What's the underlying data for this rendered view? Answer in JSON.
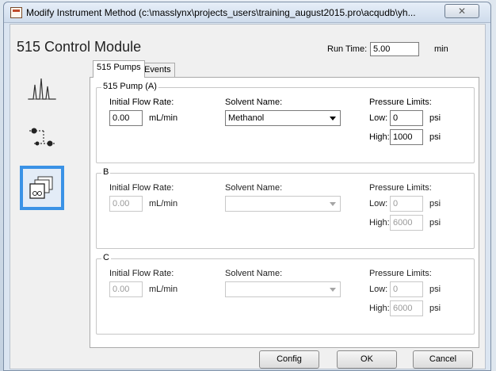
{
  "window": {
    "title": "Modify Instrument Method (c:\\masslynx\\projects_users\\training_august2015.pro\\acqudb\\yh...",
    "close_glyph": "✕"
  },
  "module": {
    "title": "515 Control Module",
    "run_time_label": "Run Time:",
    "run_time_value": "5.00",
    "run_time_unit": "min"
  },
  "sidebar": {
    "items": [
      {
        "icon": "chromatogram-icon"
      },
      {
        "icon": "flow-diagram-icon"
      },
      {
        "icon": "pump-module-icon"
      }
    ]
  },
  "tabs": [
    {
      "label": "515 Pumps"
    },
    {
      "label": "Events"
    }
  ],
  "pumps": [
    {
      "legend": "515 Pump (A)",
      "flow_label": "Initial Flow Rate:",
      "flow_value": "0.00",
      "flow_unit": "mL/min",
      "solvent_label": "Solvent Name:",
      "solvent_value": "Methanol",
      "pressure_label": "Pressure Limits:",
      "low_label": "Low:",
      "low_value": "0",
      "high_label": "High:",
      "high_value": "1000",
      "pressure_unit": "psi"
    },
    {
      "legend": "B",
      "flow_label": "Initial Flow Rate:",
      "flow_value": "0.00",
      "flow_unit": "mL/min",
      "solvent_label": "Solvent Name:",
      "solvent_value": "",
      "pressure_label": "Pressure Limits:",
      "low_label": "Low:",
      "low_value": "0",
      "high_label": "High:",
      "high_value": "6000",
      "pressure_unit": "psi"
    },
    {
      "legend": "C",
      "flow_label": "Initial Flow Rate:",
      "flow_value": "0.00",
      "flow_unit": "mL/min",
      "solvent_label": "Solvent Name:",
      "solvent_value": "",
      "pressure_label": "Pressure Limits:",
      "low_label": "Low:",
      "low_value": "0",
      "high_label": "High:",
      "high_value": "6000",
      "pressure_unit": "psi"
    }
  ],
  "buttons": {
    "config": "Config",
    "ok": "OK",
    "cancel": "Cancel"
  }
}
